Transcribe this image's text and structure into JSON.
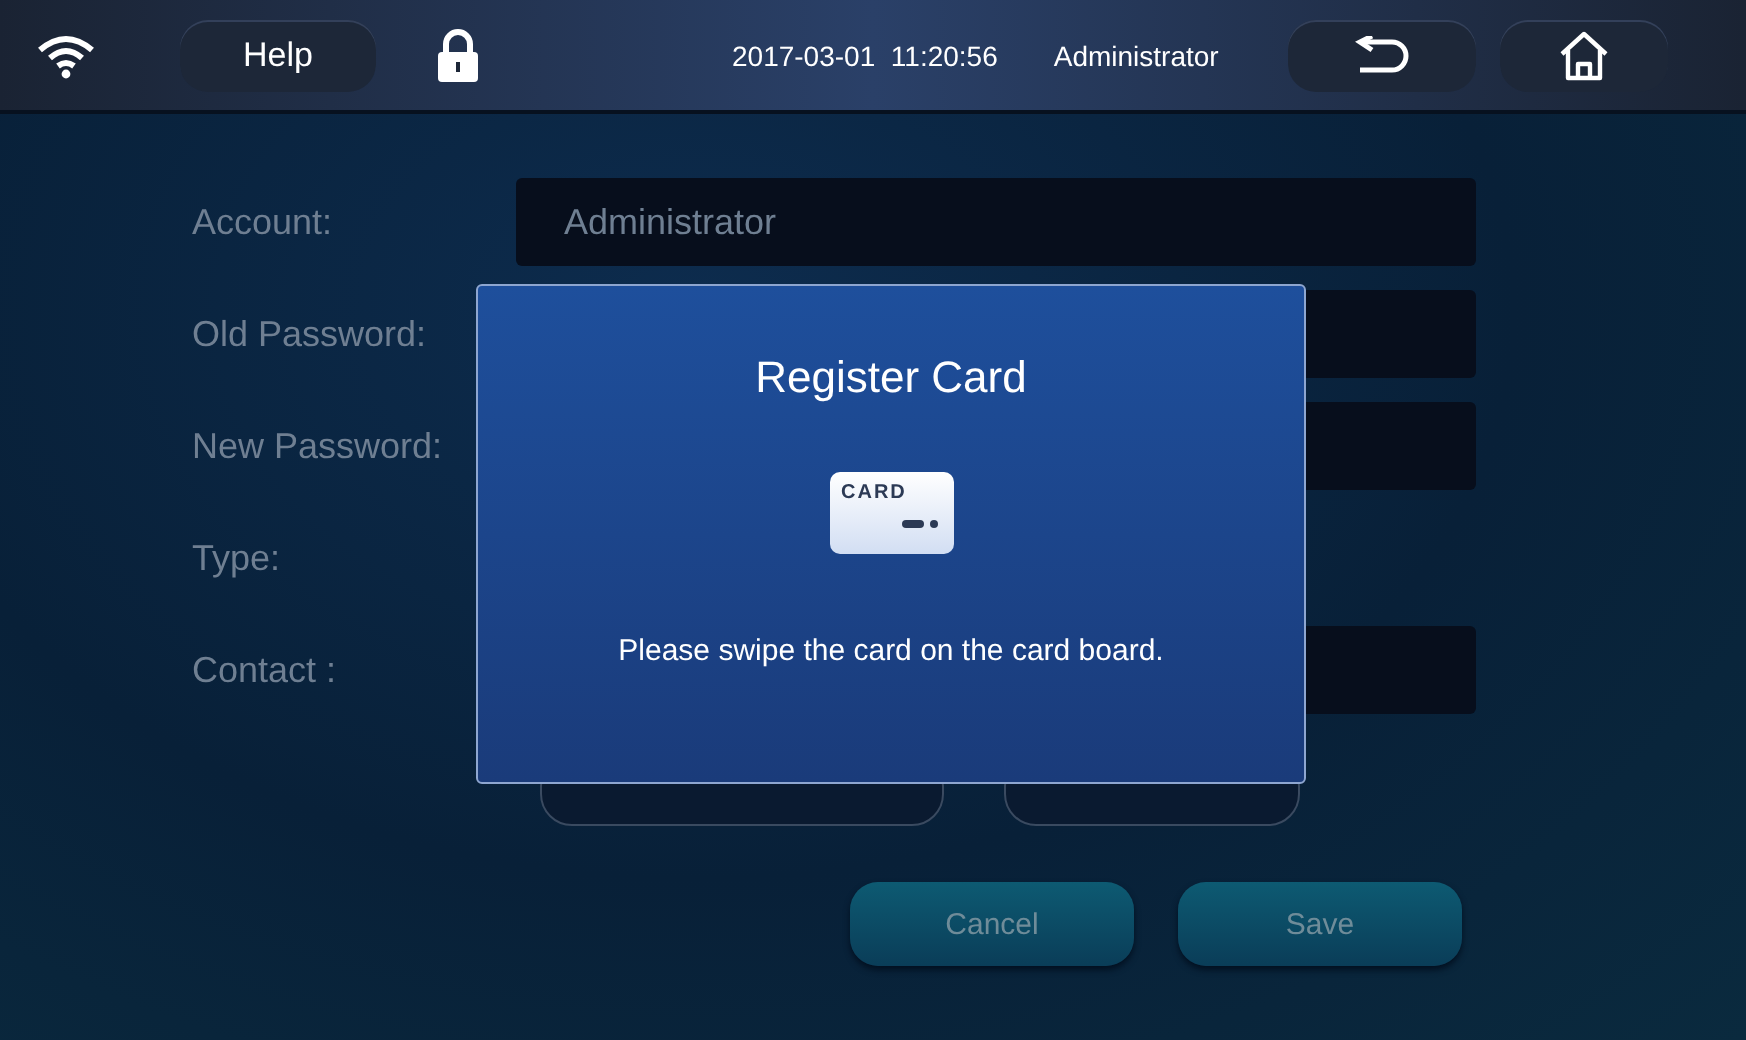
{
  "top_bar": {
    "help": "Help",
    "date": "2017-03-01",
    "time": "11:20:56",
    "user": "Administrator"
  },
  "form": {
    "fields": [
      {
        "label": "Account:",
        "value": "Administrator",
        "kind": "field"
      },
      {
        "label": "Old Password:",
        "kind": "field"
      },
      {
        "label": "New Password:",
        "kind": "field"
      },
      {
        "label": "Type:",
        "kind": "none"
      },
      {
        "label": "Contact :",
        "kind": "field"
      }
    ],
    "actions": [
      "Cancel",
      "Save"
    ]
  },
  "dialog": {
    "title": "Register Card",
    "card_label": "CARD",
    "message": "Please swipe the card on the card board."
  }
}
